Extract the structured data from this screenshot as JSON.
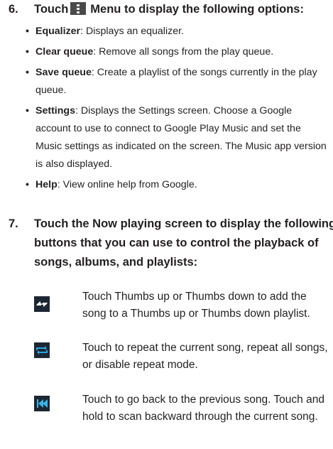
{
  "step6": {
    "number": "6.",
    "lead": "Touch",
    "menu_label": "Menu",
    "tail": "to display the following options:",
    "options": [
      {
        "term": "Equalizer",
        "desc": ": Displays an equalizer."
      },
      {
        "term": "Clear queue",
        "desc": ": Remove all songs from the play queue."
      },
      {
        "term": "Save queue",
        "desc": ": Create a playlist of the songs currently in the play queue."
      },
      {
        "term": "Settings",
        "desc": ": Displays the Settings screen. Choose a Google account to use to connect to Google Play Music and set the Music settings as indicated on the screen. The Music app version is also displayed."
      },
      {
        "term": "Help",
        "desc": ": View online help from Google."
      }
    ]
  },
  "step7": {
    "number": "7.",
    "text": "Touch the Now playing screen to display the following buttons that you can use to control the playback of songs, albums, and playlists:",
    "buttons": [
      {
        "icon": "thumbs-up-down-icon",
        "text": "Touch Thumbs up or Thumbs down to add the song to a Thumbs up or Thumbs down playlist."
      },
      {
        "icon": "repeat-icon",
        "text": "Touch to repeat the current song, repeat all songs, or disable repeat mode."
      },
      {
        "icon": "previous-track-icon",
        "text": "Touch to go back to the previous song. Touch and hold to scan backward through the current song."
      }
    ]
  },
  "colors": {
    "text": "#231f20",
    "menu_icon": "#4a4a4a",
    "icon_bg": "#1c2733",
    "repeat_blue": "#2aa4e0",
    "prev_blue": "#3ab4ea"
  }
}
